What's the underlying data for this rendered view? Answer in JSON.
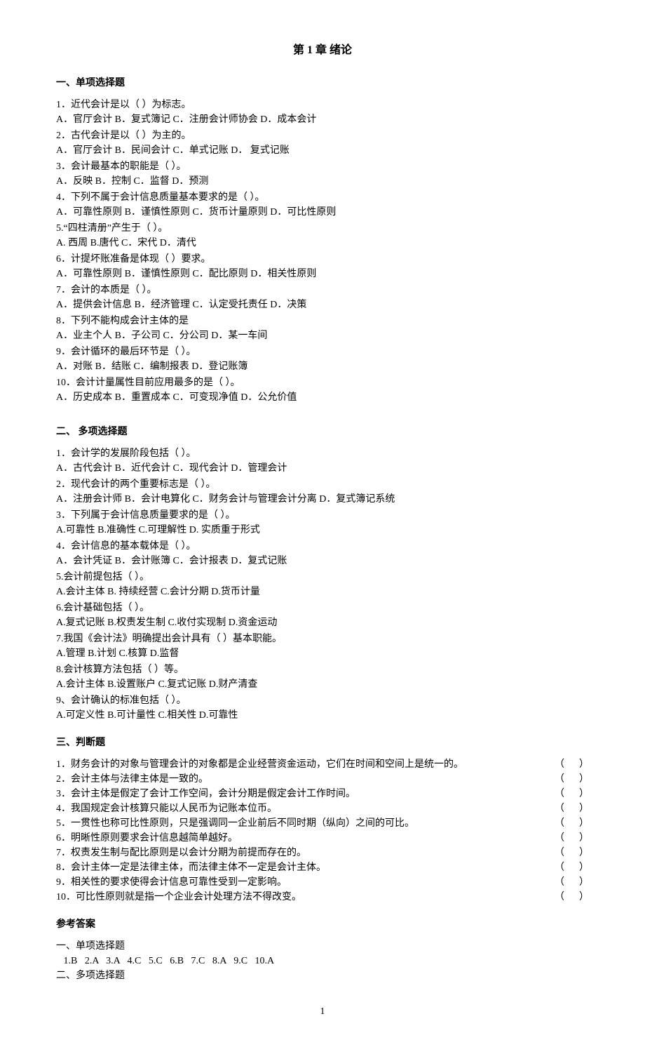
{
  "title": "第 1 章  绪论",
  "sections": {
    "s1": {
      "heading": "一、单项选择题",
      "items": [
        {
          "q": "1．近代会计是以（      ）为标志。",
          "opt": "A．官厅会计      B．复式簿记    C．注册会计师协会      D．成本会计"
        },
        {
          "q": "2．古代会计是以（      ）为主的。",
          "opt": "A．官厅会计      B．民间会计    C．单式记账         D． 复式记账"
        },
        {
          "q": "3．会计最基本的职能是（      ）。",
          "opt": "A．反映       B．控制    C．监督       D．预测"
        },
        {
          "q": "4．下列不属于会计信息质量基本要求的是（      ）。",
          "opt": "A．可靠性原则              B．谨慎性原则       C．货币计量原则         D．可比性原则"
        },
        {
          "q": "5.“四柱清册”产生于（      ）。",
          "opt": "A. 西周     B.唐代   C．宋代       D．清代"
        },
        {
          "q": "6．计提坏账准备是体现（      ）要求。",
          "opt": "A．可靠性原则          B．谨慎性原则      C．配比原则              D．相关性原则"
        },
        {
          "q": "7．会计的本质是（      ）。",
          "opt": "A．提供会计信息      B．经济管理    C．认定受托责任   D．决策"
        },
        {
          "q": "8．下列不能构成会计主体的是",
          "opt": "A．业主个人       B．子公司   C．分公司     D．某一车间"
        },
        {
          "q": "9．会计循环的最后环节是（      ）。",
          "opt": "A．对账      B．结账      C．编制报表      D．登记账簿"
        },
        {
          "q": "10．会计计量属性目前应用最多的是（      ）。",
          "opt": "A．历史成本      B．重置成本    C．可变现净值     D．公允价值"
        }
      ]
    },
    "s2": {
      "heading": "二、 多项选择题",
      "items": [
        {
          "q": "1．会计学的发展阶段包括（      ）。",
          "opt": "A．古代会计         B．近代会计        C．现代会计         D．管理会计"
        },
        {
          "q": "2．现代会计的两个重要标志是（      ）。",
          "opt": "A．注册会计师                     B．会计电算化       C．财务会计与管理会计分离       D．复式簿记系统"
        },
        {
          "q": "3．下列属于会计信息质量要求的是（      ）。",
          "opt": "A.可靠性                   B.准确性        C.可理解性                 D. 实质重于形式"
        },
        {
          "q": "4．会计信息的基本载体是（      ）。",
          "opt": "A．会计凭证    B．会计账簿      C．会计报表     D．复式记账"
        },
        {
          "q": "5.会计前提包括（    ）。",
          "opt": "A.会计主体    B. 持续经营    C.会计分期   D.货币计量"
        },
        {
          "q": "6.会计基础包括（     ）。",
          "opt": "A.复式记账   B.权责发生制   C.收付实现制   D.资金运动"
        },
        {
          "q": "7.我国《会计法》明确提出会计具有（    ）基本职能。",
          "opt": "A.管理   B.计划   C.核算   D.监督"
        },
        {
          "q": "8.会计核算方法包括（     ）等。",
          "opt": "A.会计主体   B.设置账户   C.复式记账   D.财产清查"
        },
        {
          "q": "9、会计确认的标准包括（   ）。",
          "opt": "A.可定义性    B.可计量性   C.相关性   D.可靠性"
        }
      ]
    },
    "s3": {
      "heading": "三、判断题",
      "items": [
        {
          "t": "1．财务会计的对象与管理会计的对象都是企业经营资金运动，它们在时间和空间上是统一的。",
          "b": " （      ）"
        },
        {
          "t": "2．会计主体与法律主体是一致的。",
          "b": "（      ）"
        },
        {
          "t": "3．会计主体是假定了会计工作空间，会计分期是假定会计工作时间。",
          "b": "（      ）"
        },
        {
          "t": "4．我国规定会计核算只能以人民币为记账本位币。",
          "b": "（      ）"
        },
        {
          "t": "5．一贯性也称可比性原则，只是强调同一企业前后不同时期（纵向）之间的可比。",
          "b": "（      ）"
        },
        {
          "t": "6．明晰性原则要求会计信息越简单越好。",
          "b": "（      ）"
        },
        {
          "t": "7．权责发生制与配比原则是以会计分期为前提而存在的。",
          "b": " （      ）"
        },
        {
          "t": "8．会计主体一定是法律主体，而法律主体不一定是会计主体。",
          "b": " （      ）"
        },
        {
          "t": "9．相关性的要求使得会计信息可靠性受到一定影响。",
          "b": " （      ）"
        },
        {
          "t": "10．可比性原则就是指一个企业会计处理方法不得改变。",
          "b": " （      ）"
        }
      ]
    },
    "answers": {
      "heading": "参考答案",
      "lines": [
        "一、单项选择题",
        "   1.B   2.A   3.A   4.C   5.C   6.B   7.C   8.A   9.C   10.A",
        "二、多项选择题"
      ]
    }
  },
  "pageNumber": "1"
}
